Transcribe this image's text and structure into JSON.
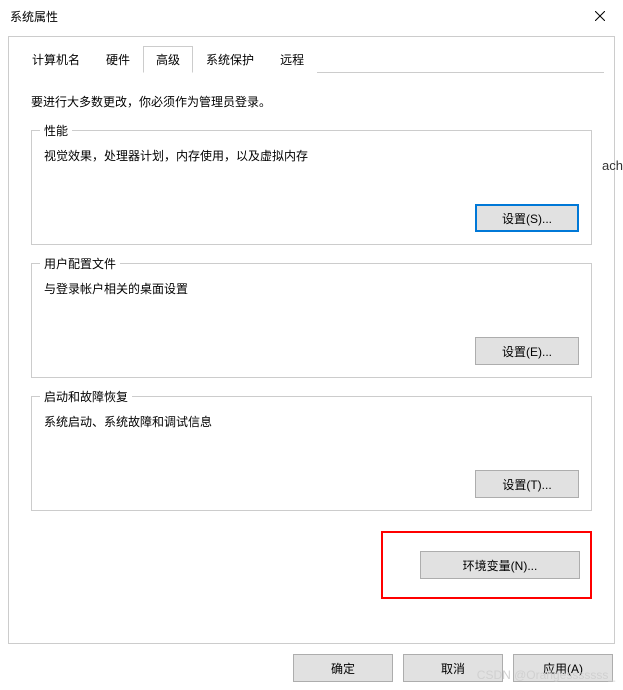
{
  "titlebar": {
    "title": "系统属性"
  },
  "tabs": {
    "items": [
      {
        "label": "计算机名"
      },
      {
        "label": "硬件"
      },
      {
        "label": "高级"
      },
      {
        "label": "系统保护"
      },
      {
        "label": "远程"
      }
    ]
  },
  "content": {
    "intro": "要进行大多数更改，你必须作为管理员登录。",
    "performance": {
      "title": "性能",
      "desc": "视觉效果，处理器计划，内存使用，以及虚拟内存",
      "button": "设置(S)..."
    },
    "userprofile": {
      "title": "用户配置文件",
      "desc": "与登录帐户相关的桌面设置",
      "button": "设置(E)..."
    },
    "startup": {
      "title": "启动和故障恢复",
      "desc": "系统启动、系统故障和调试信息",
      "button": "设置(T)..."
    },
    "env_button": "环境变量(N)..."
  },
  "footer": {
    "ok": "确定",
    "cancel": "取消",
    "apply": "应用(A)"
  },
  "watermark": "CSDN @Orangesssssss_",
  "side": "ach"
}
